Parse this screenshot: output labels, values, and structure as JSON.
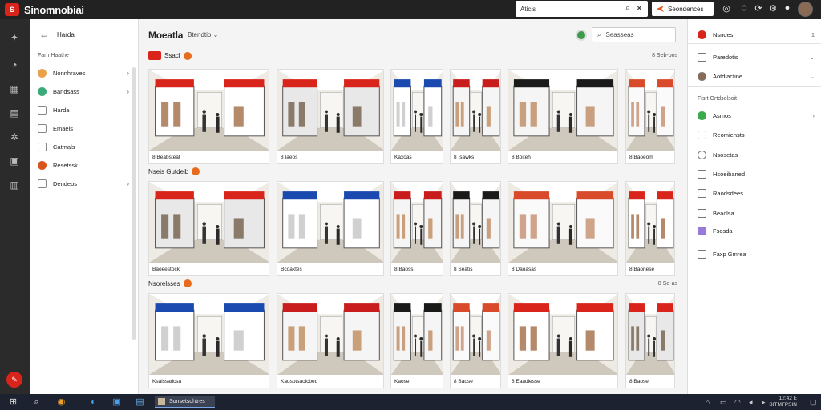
{
  "app": {
    "name": "Sinomnobiai",
    "logo_mark": "S"
  },
  "topbar": {
    "search_value": "Aticis",
    "search_icon": "search-icon",
    "clear_icon": "close-icon",
    "button_label": "Seondences",
    "icons": [
      "globe-icon",
      "bell-icon",
      "sync-icon",
      "settings-icon",
      "avatar"
    ]
  },
  "leftpanel": {
    "back_label": "Harda",
    "subheading": "Farn    Haathe",
    "items": [
      {
        "label": "Nonnhraves",
        "icon": "orange-circle-icon",
        "color": "#e8a24a",
        "chevron": "›"
      },
      {
        "label": "Bandsass",
        "icon": "green-circle-icon",
        "color": "#3aaa7a",
        "chevron": "›"
      },
      {
        "label": "Harda",
        "icon": "square-icon",
        "color": "#777777",
        "chevron": ""
      },
      {
        "label": "Emaels",
        "icon": "square-icon",
        "color": "#777777",
        "chevron": ""
      },
      {
        "label": "Catmals",
        "icon": "calendar-icon",
        "color": "#777777",
        "chevron": ""
      },
      {
        "label": "Resetssk",
        "icon": "red-circle-icon",
        "color": "#d9541c",
        "chevron": ""
      },
      {
        "label": "Dendeos",
        "icon": "pencil-icon",
        "color": "#777777",
        "chevron": "›"
      }
    ]
  },
  "main": {
    "title": "Moeatla",
    "filter_label": "Btendtio",
    "filter_chevron": "⌄",
    "search_placeholder": "Seasseas",
    "sections": [
      {
        "label": "Ssacl",
        "right": "8 Seb-pos",
        "cards": [
          "8 Beabsteat",
          "8 Iaeos",
          "Kaxoas",
          "8 Isawks",
          "8 Boiteh",
          "8 Baoeom"
        ]
      },
      {
        "label": "Nseis Gutdeib",
        "right": "",
        "cards": [
          "Baoeestock",
          "Bcoaktes",
          "8 Baoss",
          "8 Seatis",
          "8 Daoasas",
          "8 Baonese"
        ]
      },
      {
        "label": "Nsorelsses",
        "right": "8 Se-as",
        "cards": [
          "Ksaissaticsa",
          "Kausotsaoicbed",
          "Kaose",
          "8 Baose",
          "8 Eaadiesse",
          "8 Baose"
        ]
      }
    ]
  },
  "rightpanel": {
    "items": [
      {
        "label": "Nsndes",
        "icon": "red-badge-icon",
        "right": "1"
      },
      {
        "label": "Paredotis",
        "icon": "list-icon",
        "right": "⌄"
      },
      {
        "label": "Aotdiactine",
        "icon": "avatar-icon",
        "right": "⌄"
      },
      {
        "label": "Fisrt Ortdsolsoit",
        "icon": "",
        "right": ""
      },
      {
        "label": "Asmos",
        "icon": "green-badge-icon",
        "right": "›"
      },
      {
        "label": "Reomiensts",
        "icon": "doc-icon",
        "right": ""
      },
      {
        "label": "Nsosetas",
        "icon": "chat-icon",
        "right": ""
      },
      {
        "label": "Hsoeibaned",
        "icon": "image-icon",
        "right": ""
      },
      {
        "label": "Raodsdees",
        "icon": "grid-icon",
        "right": ""
      },
      {
        "label": "Beaclsa",
        "icon": "copy-icon",
        "right": ""
      },
      {
        "label": "Fsosda",
        "icon": "purple-icon",
        "right": ""
      },
      {
        "label": "Faxp Gmrea",
        "icon": "mail-icon",
        "right": ""
      }
    ]
  },
  "taskbar": {
    "app_label": "Sonsetsohtres",
    "clock_line1": "12:42 E",
    "clock_line2": "BITMFPSIN"
  },
  "colors": {
    "accent": "#d9241c",
    "topbar": "#222222",
    "rail": "#2b2b2b",
    "taskbar": "#1c2230"
  }
}
